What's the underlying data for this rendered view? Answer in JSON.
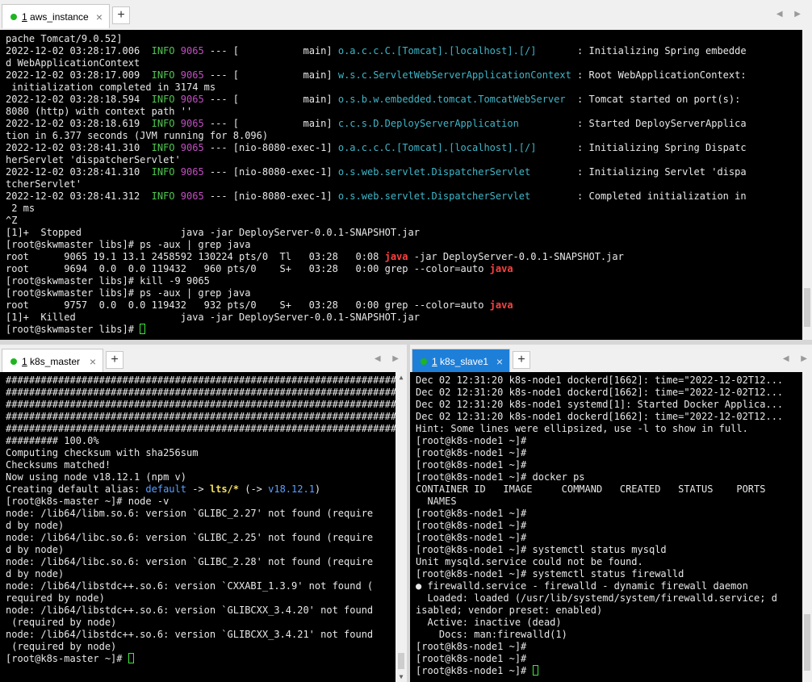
{
  "top_pane": {
    "tab": {
      "num": "1",
      "name": " aws_instance",
      "close": "×"
    },
    "lines": [
      [
        {
          "t": "pache Tomcat/9.0.52]"
        }
      ],
      [
        {
          "t": "2022-12-02 03:28:17.006  "
        },
        {
          "t": "INFO",
          "c": "g"
        },
        {
          "t": " "
        },
        {
          "t": "9065",
          "c": "m"
        },
        {
          "t": " --- [           main] "
        },
        {
          "t": "o.a.c.c.C.[Tomcat].[localhost].[/]      ",
          "c": "c"
        },
        {
          "t": " : Initializing Spring embedde"
        }
      ],
      [
        {
          "t": "d WebApplicationContext"
        }
      ],
      [
        {
          "t": "2022-12-02 03:28:17.009  "
        },
        {
          "t": "INFO",
          "c": "g"
        },
        {
          "t": " "
        },
        {
          "t": "9065",
          "c": "m"
        },
        {
          "t": " --- [           main] "
        },
        {
          "t": "w.s.c.ServletWebServerApplicationContext",
          "c": "c"
        },
        {
          "t": " : Root WebApplicationContext:"
        }
      ],
      [
        {
          "t": " initialization completed in 3174 ms"
        }
      ],
      [
        {
          "t": "2022-12-02 03:28:18.594  "
        },
        {
          "t": "INFO",
          "c": "g"
        },
        {
          "t": " "
        },
        {
          "t": "9065",
          "c": "m"
        },
        {
          "t": " --- [           main] "
        },
        {
          "t": "o.s.b.w.embedded.tomcat.TomcatWebServer ",
          "c": "c"
        },
        {
          "t": " : Tomcat started on port(s):"
        }
      ],
      [
        {
          "t": "8080 (http) with context path ''"
        }
      ],
      [
        {
          "t": "2022-12-02 03:28:18.619  "
        },
        {
          "t": "INFO",
          "c": "g"
        },
        {
          "t": " "
        },
        {
          "t": "9065",
          "c": "m"
        },
        {
          "t": " --- [           main] "
        },
        {
          "t": "c.c.s.D.DeployServerApplication         ",
          "c": "c"
        },
        {
          "t": " : Started DeployServerApplica"
        }
      ],
      [
        {
          "t": "tion in 6.377 seconds (JVM running for 8.096)"
        }
      ],
      [
        {
          "t": "2022-12-02 03:28:41.310  "
        },
        {
          "t": "INFO",
          "c": "g"
        },
        {
          "t": " "
        },
        {
          "t": "9065",
          "c": "m"
        },
        {
          "t": " --- [nio-8080-exec-1] "
        },
        {
          "t": "o.a.c.c.C.[Tomcat].[localhost].[/]      ",
          "c": "c"
        },
        {
          "t": " : Initializing Spring Dispatc"
        }
      ],
      [
        {
          "t": "herServlet 'dispatcherServlet'"
        }
      ],
      [
        {
          "t": "2022-12-02 03:28:41.310  "
        },
        {
          "t": "INFO",
          "c": "g"
        },
        {
          "t": " "
        },
        {
          "t": "9065",
          "c": "m"
        },
        {
          "t": " --- [nio-8080-exec-1] "
        },
        {
          "t": "o.s.web.servlet.DispatcherServlet       ",
          "c": "c"
        },
        {
          "t": " : Initializing Servlet 'dispa"
        }
      ],
      [
        {
          "t": "tcherServlet'"
        }
      ],
      [
        {
          "t": "2022-12-02 03:28:41.312  "
        },
        {
          "t": "INFO",
          "c": "g"
        },
        {
          "t": " "
        },
        {
          "t": "9065",
          "c": "m"
        },
        {
          "t": " --- [nio-8080-exec-1] "
        },
        {
          "t": "o.s.web.servlet.DispatcherServlet       ",
          "c": "c"
        },
        {
          "t": " : Completed initialization in"
        }
      ],
      [
        {
          "t": " 2 ms"
        }
      ],
      [
        {
          "t": "^Z"
        }
      ],
      [
        {
          "t": "[1]+  Stopped                 java -jar DeployServer-0.0.1-SNAPSHOT.jar"
        }
      ],
      [
        {
          "t": "[root@skwmaster libs]# ps -aux | grep java"
        }
      ],
      [
        {
          "t": "root      9065 19.1 13.1 2458592 130224 pts/0  Tl   03:28   0:08 "
        },
        {
          "t": "java",
          "c": "r"
        },
        {
          "t": " -jar DeployServer-0.0.1-SNAPSHOT.jar"
        }
      ],
      [
        {
          "t": "root      9694  0.0  0.0 119432   960 pts/0    S+   03:28   0:00 grep --color=auto "
        },
        {
          "t": "java",
          "c": "r"
        }
      ],
      [
        {
          "t": "[root@skwmaster libs]# kill -9 9065"
        }
      ],
      [
        {
          "t": "[root@skwmaster libs]# ps -aux | grep java"
        }
      ],
      [
        {
          "t": "root      9757  0.0  0.0 119432   932 pts/0    S+   03:28   0:00 grep --color=auto "
        },
        {
          "t": "java",
          "c": "r"
        }
      ],
      [
        {
          "t": "[1]+  Killed                  java -jar DeployServer-0.0.1-SNAPSHOT.jar"
        }
      ],
      [
        {
          "t": "[root@skwmaster libs]# "
        },
        {
          "cursor": true
        }
      ]
    ]
  },
  "left_pane": {
    "tab": {
      "num": "1",
      "name": " k8s_master",
      "close": "×"
    },
    "lines": [
      [
        {
          "t": "######################################################################"
        }
      ],
      [
        {
          "t": "######################################################################"
        }
      ],
      [
        {
          "t": "######################################################################"
        }
      ],
      [
        {
          "t": "######################################################################"
        }
      ],
      [
        {
          "t": "######################################################################"
        }
      ],
      [
        {
          "t": "######### 100.0%"
        }
      ],
      [
        {
          "t": "Computing checksum with sha256sum"
        }
      ],
      [
        {
          "t": "Checksums matched!"
        }
      ],
      [
        {
          "t": "Now using node v18.12.1 (npm v)"
        }
      ],
      [
        {
          "t": "Creating default alias: "
        },
        {
          "t": "default",
          "c": "b"
        },
        {
          "t": " -> "
        },
        {
          "t": "lts/*",
          "c": "y"
        },
        {
          "t": " (-> "
        },
        {
          "t": "v18.12.1",
          "c": "b"
        },
        {
          "t": ")"
        }
      ],
      [
        {
          "t": "[root@k8s-master ~]# node -v"
        }
      ],
      [
        {
          "t": "node: /lib64/libm.so.6: version `GLIBC_2.27' not found (require"
        }
      ],
      [
        {
          "t": "d by node)"
        }
      ],
      [
        {
          "t": "node: /lib64/libc.so.6: version `GLIBC_2.25' not found (require"
        }
      ],
      [
        {
          "t": "d by node)"
        }
      ],
      [
        {
          "t": "node: /lib64/libc.so.6: version `GLIBC_2.28' not found (require"
        }
      ],
      [
        {
          "t": "d by node)"
        }
      ],
      [
        {
          "t": "node: /lib64/libstdc++.so.6: version `CXXABI_1.3.9' not found ("
        }
      ],
      [
        {
          "t": "required by node)"
        }
      ],
      [
        {
          "t": "node: /lib64/libstdc++.so.6: version `GLIBCXX_3.4.20' not found"
        }
      ],
      [
        {
          "t": " (required by node)"
        }
      ],
      [
        {
          "t": "node: /lib64/libstdc++.so.6: version `GLIBCXX_3.4.21' not found"
        }
      ],
      [
        {
          "t": " (required by node)"
        }
      ],
      [
        {
          "t": "[root@k8s-master ~]# "
        },
        {
          "cursor": true
        }
      ]
    ]
  },
  "right_pane": {
    "tab": {
      "num": "1",
      "name": " k8s_slave1",
      "close": "×"
    },
    "lines": [
      [
        {
          "t": "Dec 02 12:31:20 k8s-node1 dockerd[1662]: time=\"2022-12-02T12..."
        }
      ],
      [
        {
          "t": "Dec 02 12:31:20 k8s-node1 dockerd[1662]: time=\"2022-12-02T12..."
        }
      ],
      [
        {
          "t": "Dec 02 12:31:20 k8s-node1 systemd[1]: Started Docker Applica..."
        }
      ],
      [
        {
          "t": "Dec 02 12:31:20 k8s-node1 dockerd[1662]: time=\"2022-12-02T12..."
        }
      ],
      [
        {
          "t": "Hint: Some lines were ellipsized, use -l to show in full."
        }
      ],
      [
        {
          "t": "[root@k8s-node1 ~]#"
        }
      ],
      [
        {
          "t": "[root@k8s-node1 ~]#"
        }
      ],
      [
        {
          "t": "[root@k8s-node1 ~]#"
        }
      ],
      [
        {
          "t": "[root@k8s-node1 ~]# docker ps"
        }
      ],
      [
        {
          "t": "CONTAINER ID   IMAGE     COMMAND   CREATED   STATUS    PORTS"
        }
      ],
      [
        {
          "t": "  NAMES"
        }
      ],
      [
        {
          "t": "[root@k8s-node1 ~]#"
        }
      ],
      [
        {
          "t": "[root@k8s-node1 ~]#"
        }
      ],
      [
        {
          "t": "[root@k8s-node1 ~]#"
        }
      ],
      [
        {
          "t": "[root@k8s-node1 ~]# systemctl status mysqld"
        }
      ],
      [
        {
          "t": "Unit mysqld.service could not be found."
        }
      ],
      [
        {
          "t": "[root@k8s-node1 ~]# systemctl status firewalld"
        }
      ],
      [
        {
          "t": "● firewalld.service - firewalld - dynamic firewall daemon"
        }
      ],
      [
        {
          "t": "  Loaded: loaded (/usr/lib/systemd/system/firewalld.service; d"
        }
      ],
      [
        {
          "t": "isabled; vendor preset: enabled)"
        }
      ],
      [
        {
          "t": "  Active: inactive (dead)"
        }
      ],
      [
        {
          "t": "    Docs: man:firewalld(1)"
        }
      ],
      [
        {
          "t": "[root@k8s-node1 ~]#"
        }
      ],
      [
        {
          "t": "[root@k8s-node1 ~]#"
        }
      ],
      [
        {
          "t": "[root@k8s-node1 ~]# "
        },
        {
          "cursor": true
        }
      ]
    ]
  },
  "ui": {
    "add_tab": "+",
    "nav_arrows": "◀ ▶",
    "scroll_up": "▲",
    "scroll_down": "▼"
  }
}
